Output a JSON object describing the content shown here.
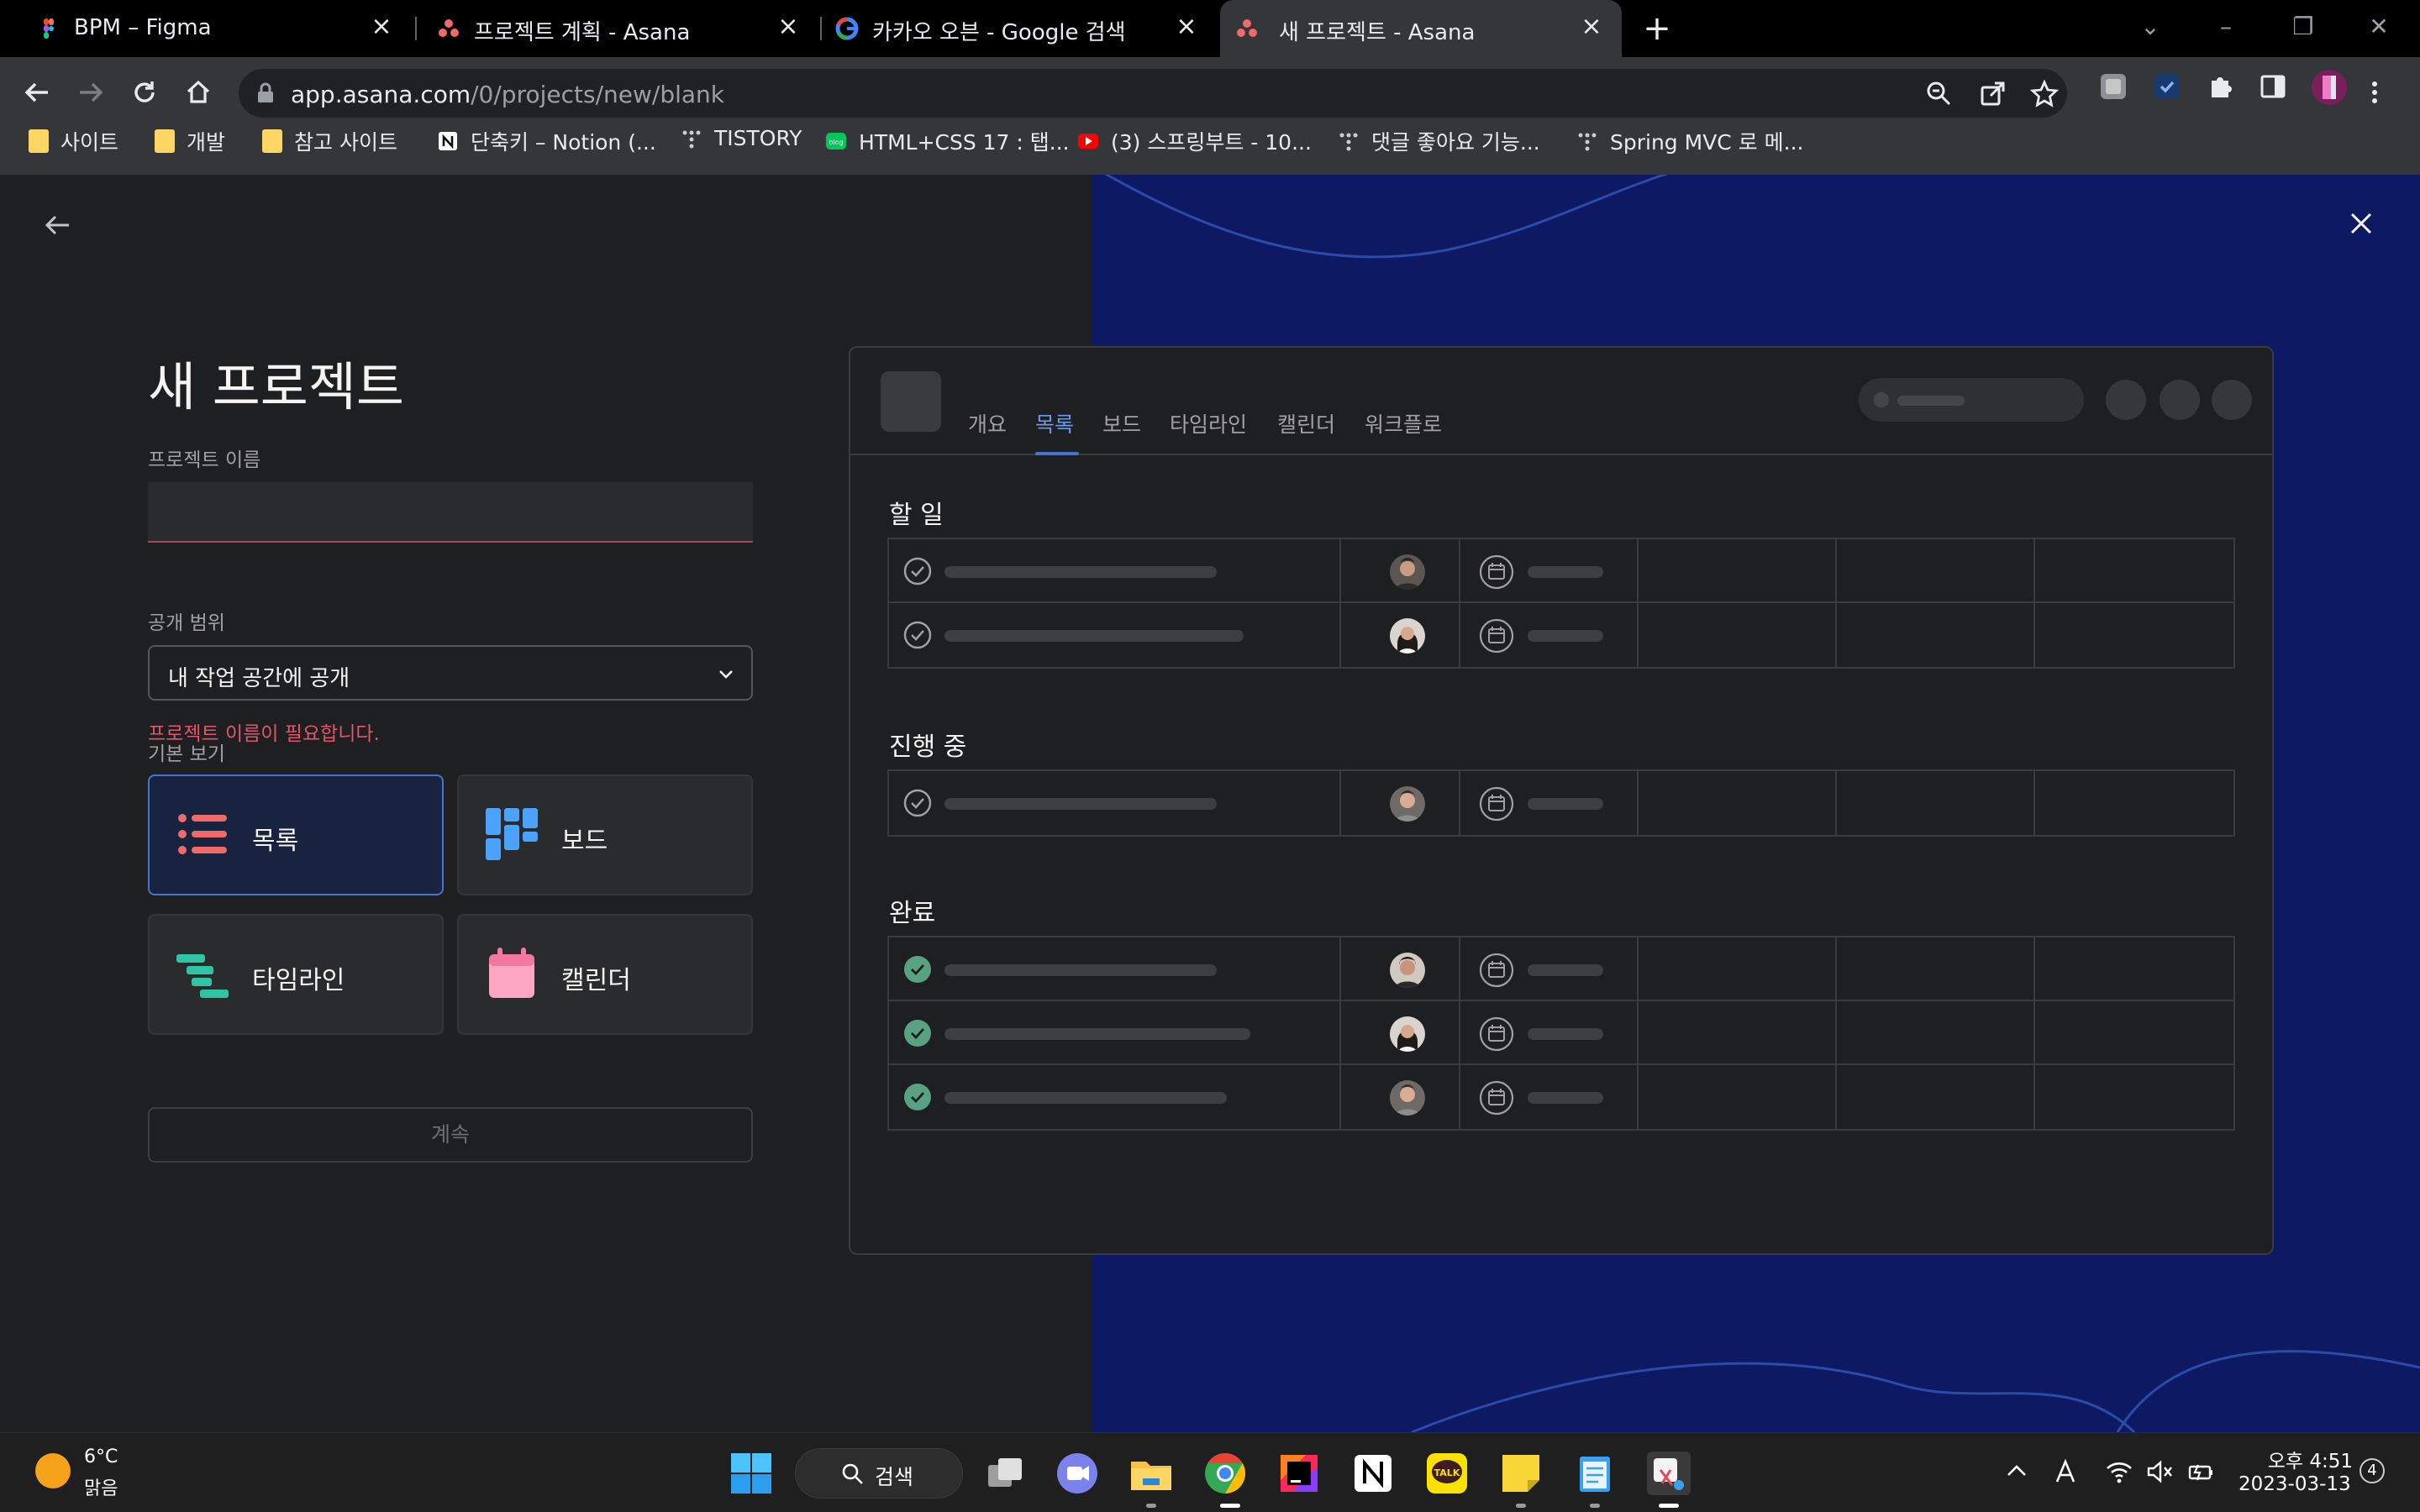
{
  "browser": {
    "tabs": [
      {
        "title": "BPM – Figma",
        "icon": "figma-icon"
      },
      {
        "title": "프로젝트 계획 - Asana",
        "icon": "asana-icon"
      },
      {
        "title": "카카오 오븐 - Google 검색",
        "icon": "google-icon"
      },
      {
        "title": "새 프로젝트 - Asana",
        "icon": "asana-icon",
        "active": true
      }
    ],
    "url_host": "app.asana.com",
    "url_path": "/0/projects/new/blank",
    "bookmarks": [
      {
        "label": "사이트",
        "icon": "folder-icon"
      },
      {
        "label": "개발",
        "icon": "folder-icon"
      },
      {
        "label": "참고 사이트",
        "icon": "folder-icon"
      },
      {
        "label": "단축키 – Notion (...",
        "icon": "notion-icon"
      },
      {
        "label": "TISTORY",
        "icon": "tistory-icon"
      },
      {
        "label": "HTML+CSS 17 : 탭...",
        "icon": "blog-icon"
      },
      {
        "label": "(3) 스프링부트 - 10...",
        "icon": "youtube-icon"
      },
      {
        "label": "댓글 좋아요 기능...",
        "icon": "tistory-icon"
      },
      {
        "label": "Spring MVC 로 메...",
        "icon": "tistory-icon"
      }
    ]
  },
  "form": {
    "title": "새 프로젝트",
    "name_label": "프로젝트 이름",
    "name_value": "",
    "name_error": "프로젝트 이름이 필요합니다.",
    "privacy_label": "공개 범위",
    "privacy_value": "내 작업 공간에 공개",
    "default_view_label": "기본 보기",
    "views": [
      {
        "label": "목록",
        "icon": "list-icon",
        "selected": true
      },
      {
        "label": "보드",
        "icon": "board-icon",
        "selected": false
      },
      {
        "label": "타임라인",
        "icon": "timeline-icon",
        "selected": false
      },
      {
        "label": "캘린더",
        "icon": "calendar-icon",
        "selected": false
      }
    ],
    "continue_label": "계속"
  },
  "preview": {
    "tabs": [
      "개요",
      "목록",
      "보드",
      "타임라인",
      "캘린더",
      "워크플로"
    ],
    "active_tab": "목록",
    "sections": [
      {
        "title": "할 일",
        "tasks": [
          {
            "done": false
          },
          {
            "done": false
          }
        ]
      },
      {
        "title": "진행 중",
        "tasks": [
          {
            "done": false
          }
        ]
      },
      {
        "title": "완료",
        "tasks": [
          {
            "done": true
          },
          {
            "done": true
          },
          {
            "done": true
          }
        ]
      }
    ]
  },
  "taskbar": {
    "weather_temp": "6°C",
    "weather_desc": "맑음",
    "search_label": "검색",
    "time": "오후 4:51",
    "date": "2023-03-13",
    "notification_count": "4"
  },
  "colors": {
    "accent_blue": "#4573d2",
    "error_red": "#e3556a",
    "brand_navy": "#0d1a63",
    "done_green": "#58a182"
  }
}
